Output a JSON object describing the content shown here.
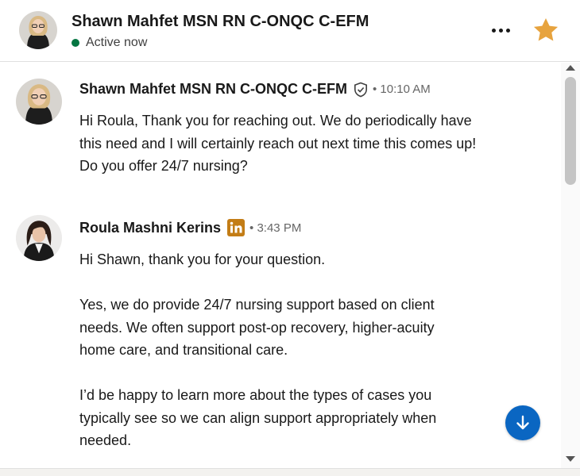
{
  "header": {
    "name": "Shawn Mahfet MSN RN C-ONQC C-EFM",
    "status": "Active now",
    "more_icon": "more-horizontal-icon",
    "star_icon": "star-icon"
  },
  "messages": [
    {
      "sender": "Shawn Mahfet MSN RN C-ONQC C-EFM",
      "badge_icon": "verified-shield-icon",
      "time": "10:10 AM",
      "paragraphs": [
        "Hi Roula, Thank you for reaching out. We do periodically have this need and I will certainly reach out next time this comes up! Do you offer 24/7 nursing?"
      ]
    },
    {
      "sender": "Roula Mashni Kerins",
      "badge_icon": "linkedin-icon",
      "time": "3:43 PM",
      "paragraphs": [
        "Hi Shawn, thank you for your question.",
        "Yes, we do provide 24/7 nursing support based on client needs. We often support post-op recovery, higher-acuity home care, and transitional care.",
        "I’d be happy to learn more about the types of cases you typically see so we can align support appropriately when needed."
      ]
    }
  ],
  "jump_icon": "arrow-down-icon",
  "colors": {
    "accent": "#0a66c2",
    "online": "#057642",
    "star": "#e7a33e",
    "linkedin_badge": "#c37d16"
  }
}
